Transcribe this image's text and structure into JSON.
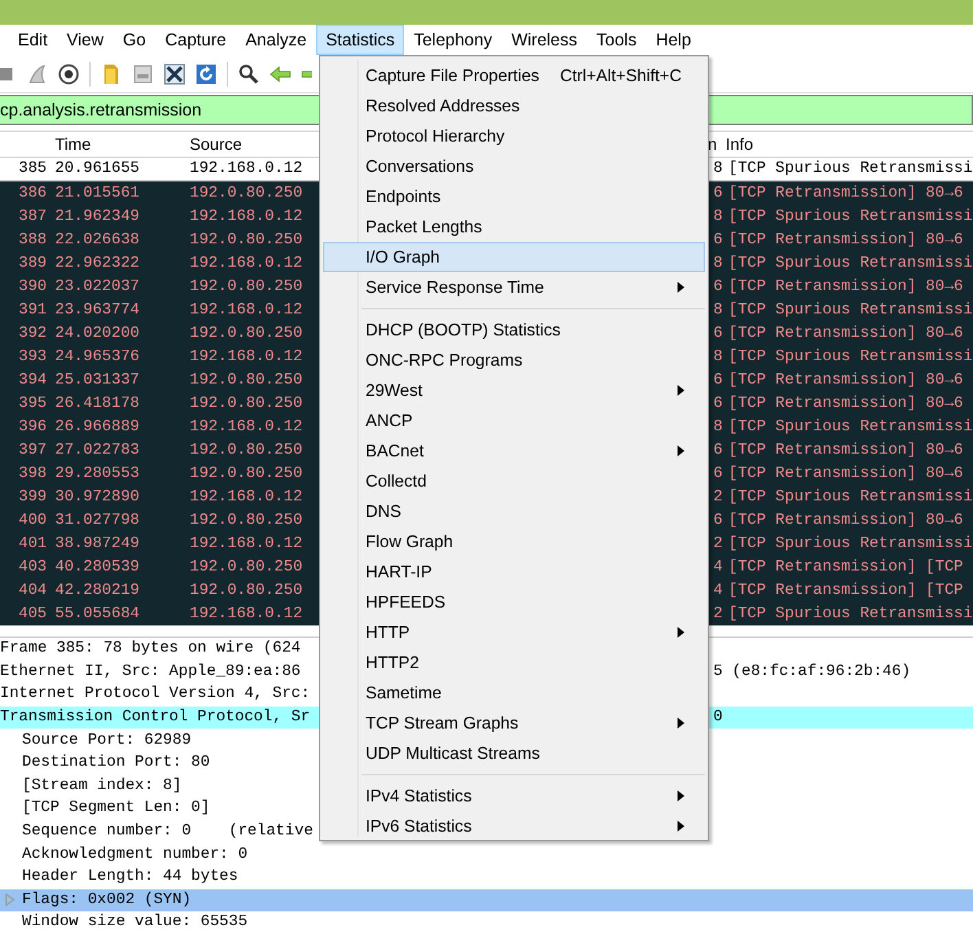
{
  "menu_bar": [
    {
      "label": "Edit",
      "selected": false
    },
    {
      "label": "View",
      "selected": false
    },
    {
      "label": "Go",
      "selected": false
    },
    {
      "label": "Capture",
      "selected": false
    },
    {
      "label": "Analyze",
      "selected": false
    },
    {
      "label": "Statistics",
      "selected": true
    },
    {
      "label": "Telephony",
      "selected": false
    },
    {
      "label": "Wireless",
      "selected": false
    },
    {
      "label": "Tools",
      "selected": false
    },
    {
      "label": "Help",
      "selected": false
    }
  ],
  "toolbar": [
    {
      "kind": "stop"
    },
    {
      "kind": "restart"
    },
    {
      "kind": "options"
    },
    {
      "kind": "open"
    },
    {
      "kind": "file"
    },
    {
      "kind": "close"
    },
    {
      "kind": "reload"
    },
    {
      "kind": "find"
    },
    {
      "kind": "back"
    },
    {
      "kind": "forward"
    }
  ],
  "filter": {
    "value": "cp.analysis.retransmission"
  },
  "packet_list": {
    "columns": [
      {
        "label": "Time"
      },
      {
        "label": "Source"
      },
      {
        "label": "n"
      },
      {
        "label": "Info"
      }
    ],
    "rows": [
      {
        "no": "385",
        "time": "20.961655",
        "source": "192.168.0.12",
        "column_4": "8",
        "info": "[TCP Spurious Retransmissi",
        "selected": true
      },
      {
        "no": "386",
        "time": "21.015561",
        "source": "192.0.80.250",
        "column_4": "6",
        "info": "[TCP Retransmission] 80→6",
        "selected": false
      },
      {
        "no": "387",
        "time": "21.962349",
        "source": "192.168.0.12",
        "column_4": "8",
        "info": "[TCP Spurious Retransmissi",
        "selected": false
      },
      {
        "no": "388",
        "time": "22.026638",
        "source": "192.0.80.250",
        "column_4": "6",
        "info": "[TCP Retransmission] 80→6",
        "selected": false
      },
      {
        "no": "389",
        "time": "22.962322",
        "source": "192.168.0.12",
        "column_4": "8",
        "info": "[TCP Spurious Retransmissi",
        "selected": false
      },
      {
        "no": "390",
        "time": "23.022037",
        "source": "192.0.80.250",
        "column_4": "6",
        "info": "[TCP Retransmission] 80→6",
        "selected": false
      },
      {
        "no": "391",
        "time": "23.963774",
        "source": "192.168.0.12",
        "column_4": "8",
        "info": "[TCP Spurious Retransmissi",
        "selected": false
      },
      {
        "no": "392",
        "time": "24.020200",
        "source": "192.0.80.250",
        "column_4": "6",
        "info": "[TCP Retransmission] 80→6",
        "selected": false
      },
      {
        "no": "393",
        "time": "24.965376",
        "source": "192.168.0.12",
        "column_4": "8",
        "info": "[TCP Spurious Retransmissi",
        "selected": false
      },
      {
        "no": "394",
        "time": "25.031337",
        "source": "192.0.80.250",
        "column_4": "6",
        "info": "[TCP Retransmission] 80→6",
        "selected": false
      },
      {
        "no": "395",
        "time": "26.418178",
        "source": "192.0.80.250",
        "column_4": "6",
        "info": "[TCP Retransmission] 80→6",
        "selected": false
      },
      {
        "no": "396",
        "time": "26.966889",
        "source": "192.168.0.12",
        "column_4": "8",
        "info": "[TCP Spurious Retransmissi",
        "selected": false
      },
      {
        "no": "397",
        "time": "27.022783",
        "source": "192.0.80.250",
        "column_4": "6",
        "info": "[TCP Retransmission] 80→6",
        "selected": false
      },
      {
        "no": "398",
        "time": "29.280553",
        "source": "192.0.80.250",
        "column_4": "6",
        "info": "[TCP Retransmission] 80→6",
        "selected": false
      },
      {
        "no": "399",
        "time": "30.972890",
        "source": "192.168.0.12",
        "column_4": "2",
        "info": "[TCP Spurious Retransmissi",
        "selected": false
      },
      {
        "no": "400",
        "time": "31.027798",
        "source": "192.0.80.250",
        "column_4": "6",
        "info": "[TCP Retransmission] 80→6",
        "selected": false
      },
      {
        "no": "401",
        "time": "38.987249",
        "source": "192.168.0.12",
        "column_4": "2",
        "info": "[TCP Spurious Retransmissi",
        "selected": false
      },
      {
        "no": "403",
        "time": "40.280539",
        "source": "192.0.80.250",
        "column_4": "4",
        "info": "[TCP Retransmission] [TCP",
        "selected": false
      },
      {
        "no": "404",
        "time": "42.280219",
        "source": "192.0.80.250",
        "column_4": "4",
        "info": "[TCP Retransmission] [TCP",
        "selected": false
      },
      {
        "no": "405",
        "time": "55.055684",
        "source": "192.168.0.12",
        "column_4": "2",
        "info": "[TCP Spurious Retransmissi",
        "selected": false
      }
    ]
  },
  "packet_details": [
    {
      "text": "Frame 385: 78 bytes on wire (624",
      "highlighted": false,
      "selected": false
    },
    {
      "text": "Ethernet II, Src: Apple_89:ea:86",
      "tail": "5 (e8:fc:af:96:2b:46)",
      "highlighted": false,
      "selected": false
    },
    {
      "text": "Internet Protocol Version 4, Src:",
      "highlighted": false,
      "selected": false
    },
    {
      "text": "Transmission Control Protocol, Sr",
      "tail": "0",
      "highlighted": true,
      "selected": false,
      "children": [
        {
          "text": "Source Port: 62989",
          "expandable": false,
          "selected": false
        },
        {
          "text": "Destination Port: 80",
          "expandable": false,
          "selected": false
        },
        {
          "text": "[Stream index: 8]",
          "expandable": false,
          "selected": false
        },
        {
          "text": "[TCP Segment Len: 0]",
          "expandable": false,
          "selected": false
        },
        {
          "text": "Sequence number: 0    (relative",
          "expandable": false,
          "selected": false
        },
        {
          "text": "Acknowledgment number: 0",
          "expandable": false,
          "selected": false
        },
        {
          "text": "Header Length: 44 bytes",
          "expandable": false,
          "selected": false
        },
        {
          "text": "Flags: 0x002 (SYN)",
          "expandable": true,
          "selected": true
        },
        {
          "text": "Window size value: 65535",
          "expandable": false,
          "selected": false
        }
      ]
    }
  ],
  "statistics_menu": {
    "groups": [
      [
        {
          "label": "Capture File Properties",
          "shortcut": "Ctrl+Alt+Shift+C",
          "submenu": false,
          "selected": false
        },
        {
          "label": "Resolved Addresses",
          "submenu": false,
          "selected": false
        },
        {
          "label": "Protocol Hierarchy",
          "submenu": false,
          "selected": false
        },
        {
          "label": "Conversations",
          "submenu": false,
          "selected": false
        },
        {
          "label": "Endpoints",
          "submenu": false,
          "selected": false
        },
        {
          "label": "Packet Lengths",
          "submenu": false,
          "selected": false
        },
        {
          "label": "I/O Graph",
          "submenu": false,
          "selected": true
        },
        {
          "label": "Service Response Time",
          "submenu": true,
          "selected": false
        }
      ],
      [
        {
          "label": "DHCP (BOOTP) Statistics",
          "submenu": false,
          "selected": false
        },
        {
          "label": "ONC-RPC Programs",
          "submenu": false,
          "selected": false
        },
        {
          "label": "29West",
          "submenu": true,
          "selected": false
        },
        {
          "label": "ANCP",
          "submenu": false,
          "selected": false
        },
        {
          "label": "BACnet",
          "submenu": true,
          "selected": false
        },
        {
          "label": "Collectd",
          "submenu": false,
          "selected": false
        },
        {
          "label": "DNS",
          "submenu": false,
          "selected": false
        },
        {
          "label": "Flow Graph",
          "submenu": false,
          "selected": false
        },
        {
          "label": "HART-IP",
          "submenu": false,
          "selected": false
        },
        {
          "label": "HPFEEDS",
          "submenu": false,
          "selected": false
        },
        {
          "label": "HTTP",
          "submenu": true,
          "selected": false
        },
        {
          "label": "HTTP2",
          "submenu": false,
          "selected": false
        },
        {
          "label": "Sametime",
          "submenu": false,
          "selected": false
        },
        {
          "label": "TCP Stream Graphs",
          "submenu": true,
          "selected": false
        },
        {
          "label": "UDP Multicast Streams",
          "submenu": false,
          "selected": false
        }
      ],
      [
        {
          "label": "IPv4 Statistics",
          "submenu": true,
          "selected": false
        },
        {
          "label": "IPv6 Statistics",
          "submenu": true,
          "selected": false
        }
      ]
    ]
  }
}
